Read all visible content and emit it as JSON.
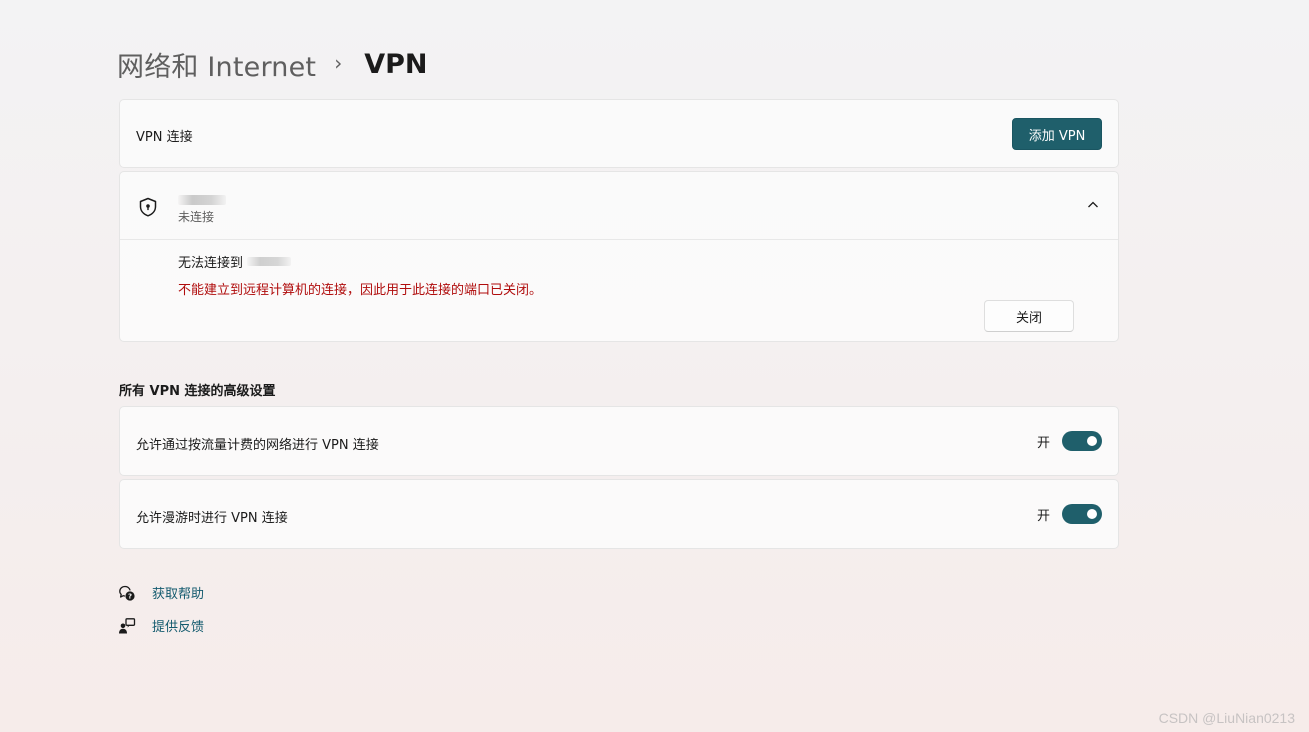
{
  "breadcrumb": {
    "parent": "网络和 Internet",
    "separator": "›",
    "current": "VPN"
  },
  "vpn_connections": {
    "label": "VPN 连接",
    "add_button": "添加 VPN"
  },
  "vpn_item": {
    "status": "未连接",
    "error_title": "无法连接到",
    "error_message": "不能建立到远程计算机的连接，因此用于此连接的端口已关闭。",
    "close_button": "关闭"
  },
  "advanced": {
    "title": "所有 VPN 连接的高级设置",
    "settings": [
      {
        "label": "允许通过按流量计费的网络进行 VPN 连接",
        "state": "开",
        "on": true
      },
      {
        "label": "允许漫游时进行 VPN 连接",
        "state": "开",
        "on": true
      }
    ]
  },
  "links": {
    "help": "获取帮助",
    "feedback": "提供反馈"
  },
  "watermark": "CSDN @LiuNian0213",
  "colors": {
    "accent": "#1f5f6b",
    "error": "#b00c0c",
    "link": "#135a6e"
  }
}
